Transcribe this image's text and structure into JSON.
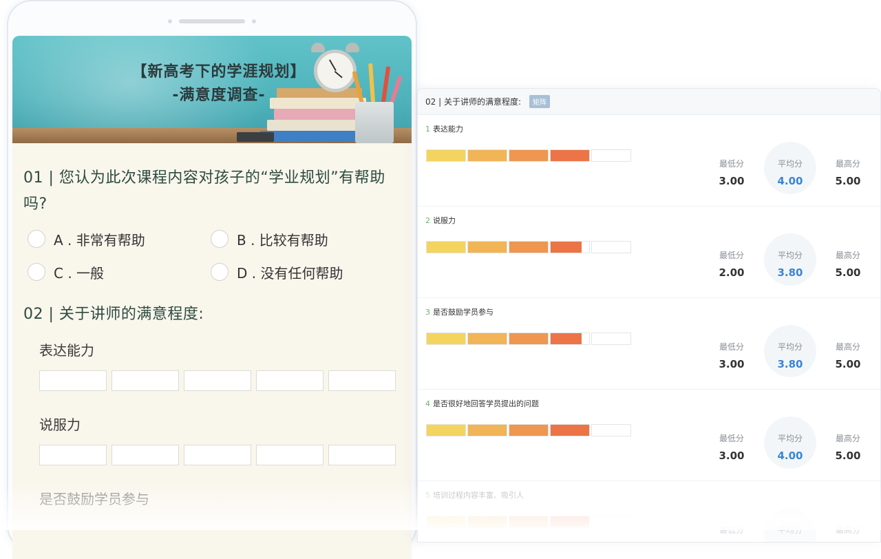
{
  "phone": {
    "banner": {
      "title_line1": "【新高考下的学涯规划】",
      "title_line2": "-满意度调查-"
    },
    "q1": {
      "title": "01 | 您认为此次课程内容对孩子的“学业规划”有帮助吗?",
      "options": [
        "A . 非常有帮助",
        "B . 比较有帮助",
        "C . 一般",
        "D . 没有任何帮助"
      ]
    },
    "q2": {
      "title": "02 | 关于讲师的满意程度:",
      "items": [
        "表达能力",
        "说服力",
        "是否鼓励学员参与"
      ]
    }
  },
  "panel": {
    "title": "02 | 关于讲师的满意程度:",
    "badge": "矩阵",
    "labels": {
      "min": "最低分",
      "avg": "平均分",
      "max": "最高分"
    },
    "bar_colors": [
      "#f3d45e",
      "#f1b456",
      "#ef9650",
      "#ec7447",
      "#ffffff"
    ],
    "avg_color": "#3a85d6",
    "items": [
      {
        "num": "1",
        "label": "表达能力",
        "min": "3.00",
        "avg": "4.00",
        "max": "5.00",
        "level": 4.0
      },
      {
        "num": "2",
        "label": "说服力",
        "min": "2.00",
        "avg": "3.80",
        "max": "5.00",
        "level": 3.8
      },
      {
        "num": "3",
        "label": "是否鼓励学员参与",
        "min": "3.00",
        "avg": "3.80",
        "max": "5.00",
        "level": 3.8
      },
      {
        "num": "4",
        "label": "是否很好地回答学员提出的问题",
        "min": "3.00",
        "avg": "4.00",
        "max": "5.00",
        "level": 4.0
      },
      {
        "num": "5",
        "label": "培训过程内容丰富、吸引人",
        "min": "",
        "avg": "",
        "max": "",
        "level": 4.0
      }
    ]
  }
}
